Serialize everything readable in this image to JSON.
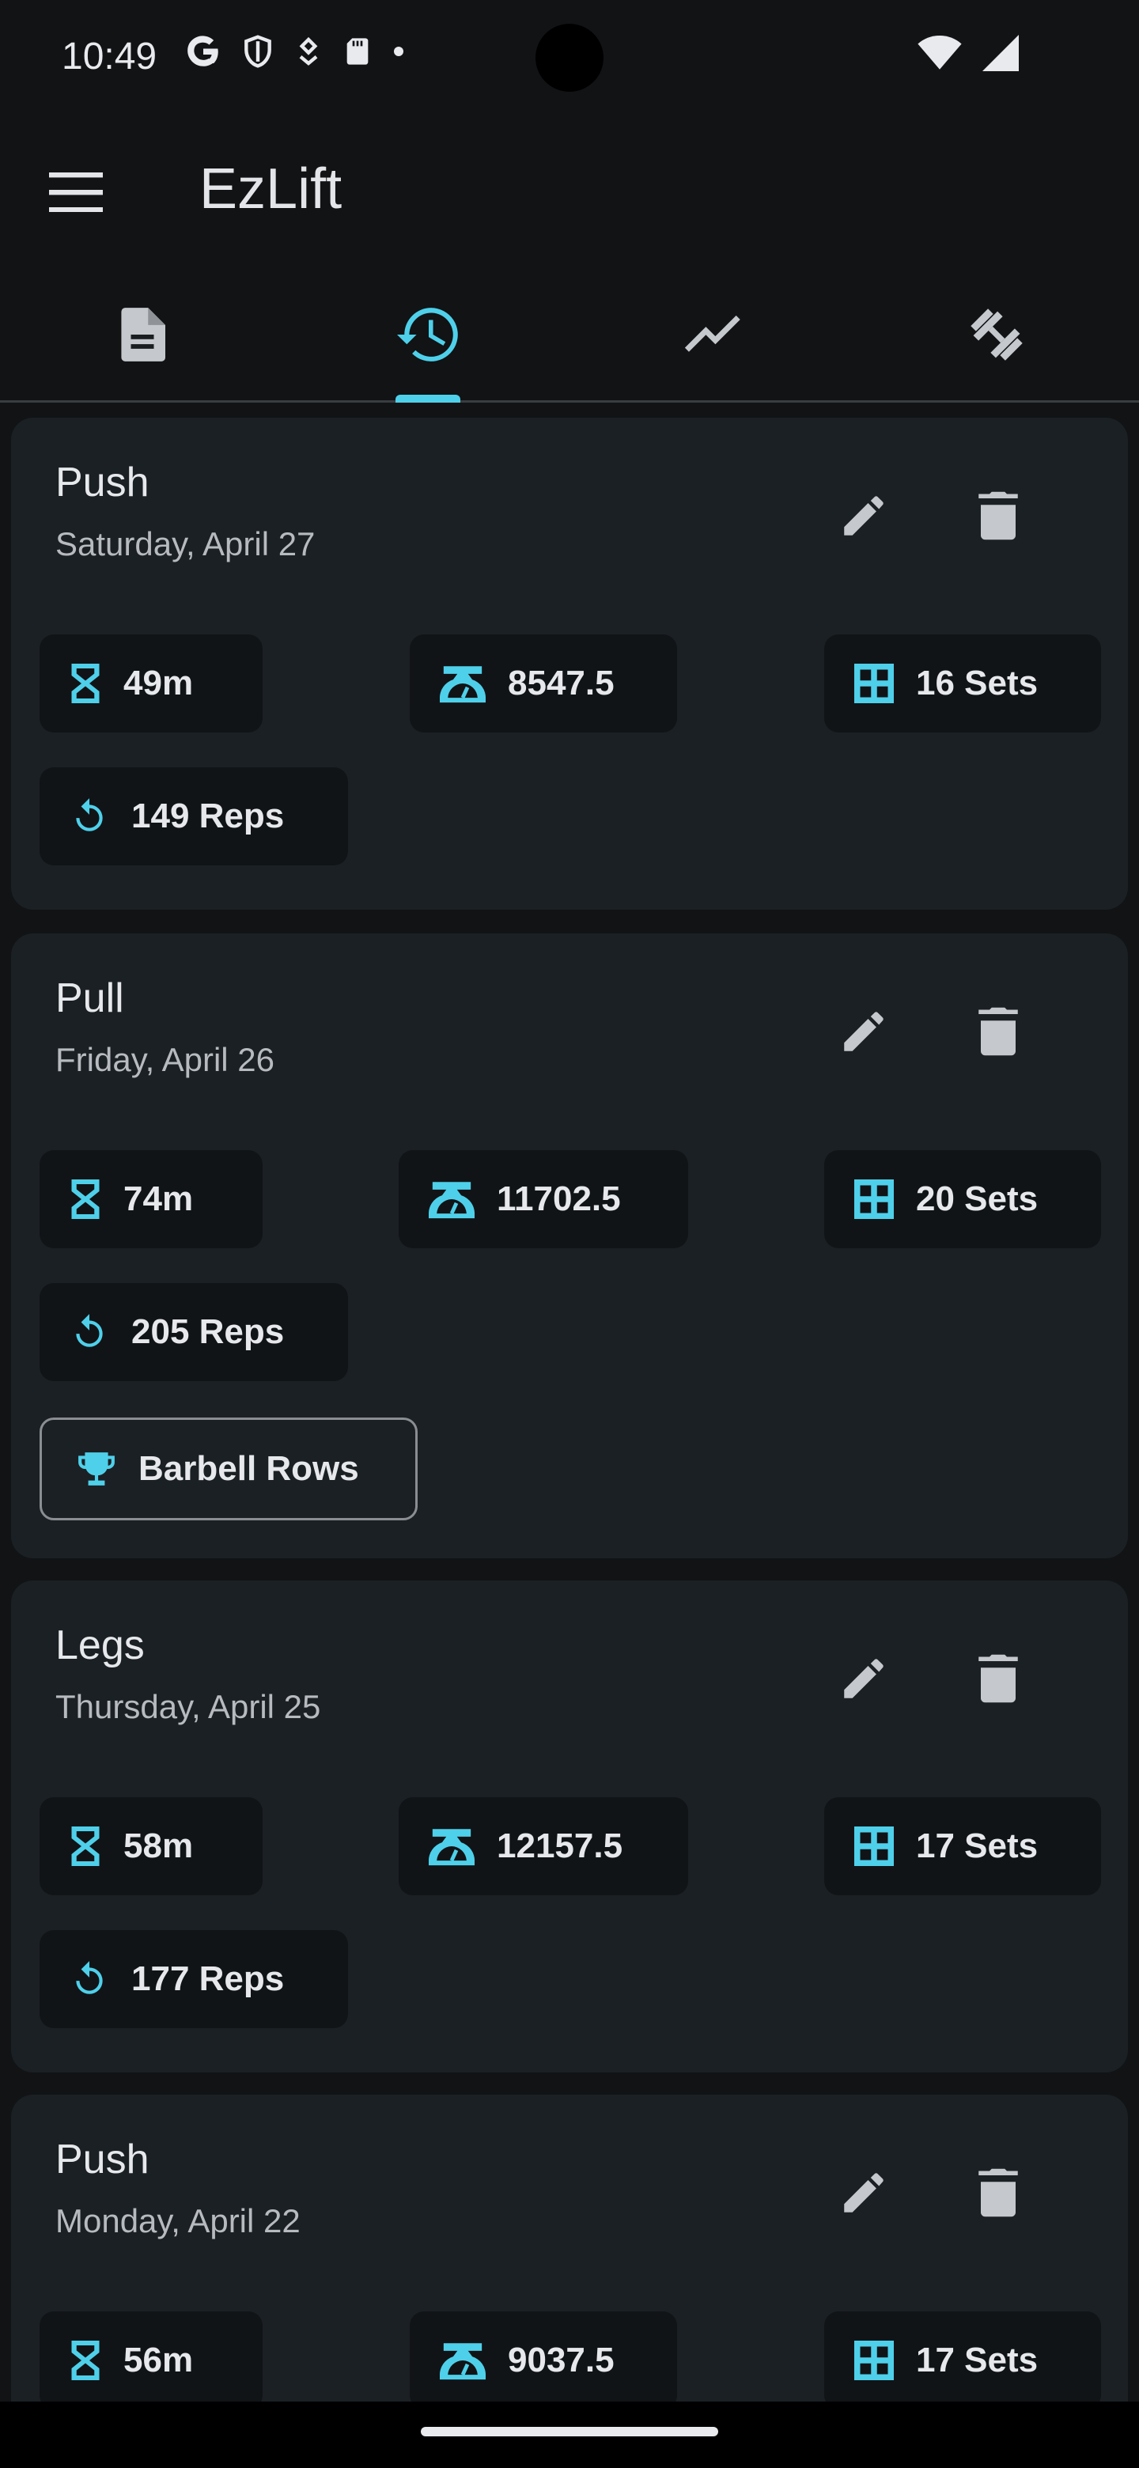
{
  "status_bar": {
    "time": "10:49"
  },
  "app": {
    "title": "EzLift"
  },
  "tabs": [
    {
      "name": "templates",
      "icon": "document-icon",
      "selected": false
    },
    {
      "name": "history",
      "icon": "history-icon",
      "selected": true
    },
    {
      "name": "charts",
      "icon": "chart-icon",
      "selected": false
    },
    {
      "name": "exercises",
      "icon": "dumbbell-icon",
      "selected": false
    }
  ],
  "colors": {
    "accent": "#4fd0ea",
    "card": "#1b2024",
    "chip": "#111417",
    "background": "#111315"
  },
  "workouts": [
    {
      "title": "Push",
      "date": "Saturday, April 27",
      "duration": "49m",
      "volume": "8547.5",
      "sets": "16 Sets",
      "reps": "149 Reps"
    },
    {
      "title": "Pull",
      "date": "Friday, April 26",
      "duration": "74m",
      "volume": "11702.5",
      "sets": "20 Sets",
      "reps": "205 Reps",
      "pr": "Barbell Rows"
    },
    {
      "title": "Legs",
      "date": "Thursday, April 25",
      "duration": "58m",
      "volume": "12157.5",
      "sets": "17 Sets",
      "reps": "177 Reps"
    },
    {
      "title": "Push",
      "date": "Monday, April 22",
      "duration": "56m",
      "volume": "9037.5",
      "sets": "17 Sets"
    }
  ]
}
